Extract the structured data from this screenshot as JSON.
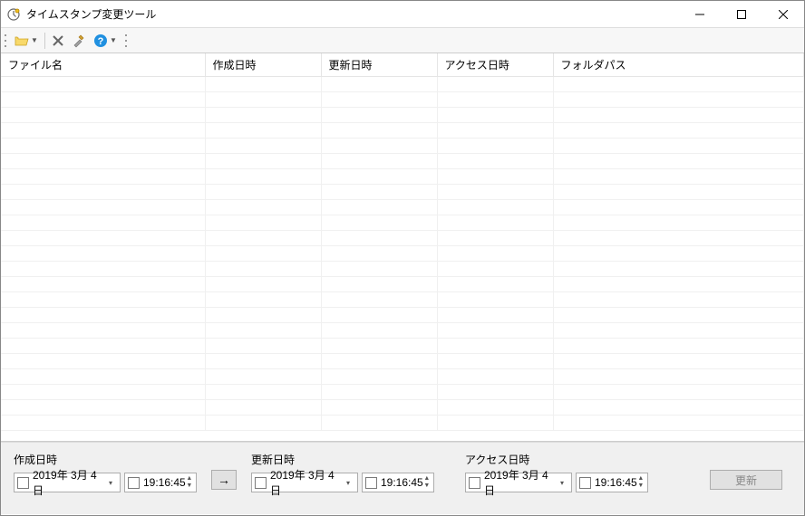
{
  "window": {
    "title": "タイムスタンプ変更ツール"
  },
  "columns": {
    "filename": "ファイル名",
    "created": "作成日時",
    "modified": "更新日時",
    "accessed": "アクセス日時",
    "folder": "フォルダパス"
  },
  "panel": {
    "created": {
      "label": "作成日時",
      "date": "2019年 3月 4日",
      "time": "19:16:45"
    },
    "modified": {
      "label": "更新日時",
      "date": "2019年 3月 4日",
      "time": "19:16:45"
    },
    "accessed": {
      "label": "アクセス日時",
      "date": "2019年 3月 4日",
      "time": "19:16:45"
    },
    "apply_arrow": "→",
    "update_button": "更新"
  }
}
